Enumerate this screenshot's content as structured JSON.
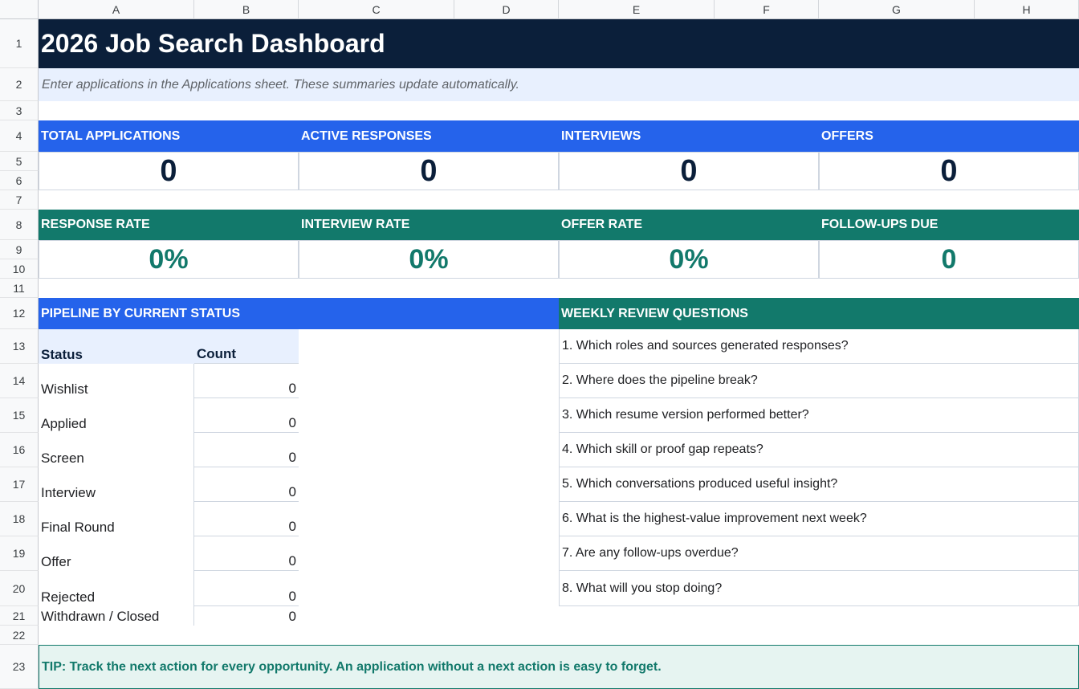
{
  "columns": [
    "A",
    "B",
    "C",
    "D",
    "E",
    "F",
    "G",
    "H"
  ],
  "rows": [
    "1",
    "2",
    "3",
    "4",
    "5",
    "6",
    "7",
    "8",
    "9",
    "10",
    "11",
    "12",
    "13",
    "14",
    "15",
    "16",
    "17",
    "18",
    "19",
    "20",
    "21",
    "22",
    "23"
  ],
  "title": "2026 Job Search Dashboard",
  "subtitle": "Enter applications in the Applications sheet. These summaries update automatically.",
  "kpis_top": [
    {
      "label": "TOTAL APPLICATIONS",
      "value": "0"
    },
    {
      "label": "ACTIVE RESPONSES",
      "value": "0"
    },
    {
      "label": "INTERVIEWS",
      "value": "0"
    },
    {
      "label": "OFFERS",
      "value": "0"
    }
  ],
  "kpis_rates": [
    {
      "label": "RESPONSE RATE",
      "value": "0%"
    },
    {
      "label": "INTERVIEW RATE",
      "value": "0%"
    },
    {
      "label": "OFFER RATE",
      "value": "0%"
    },
    {
      "label": "FOLLOW-UPS DUE",
      "value": "0"
    }
  ],
  "pipeline": {
    "title": "PIPELINE BY CURRENT STATUS",
    "col_status": "Status",
    "col_count": "Count",
    "rows": [
      {
        "status": "Wishlist",
        "count": "0"
      },
      {
        "status": "Applied",
        "count": "0"
      },
      {
        "status": "Screen",
        "count": "0"
      },
      {
        "status": "Interview",
        "count": "0"
      },
      {
        "status": "Final Round",
        "count": "0"
      },
      {
        "status": "Offer",
        "count": "0"
      },
      {
        "status": "Rejected",
        "count": "0"
      },
      {
        "status": "Withdrawn / Closed",
        "count": "0"
      }
    ]
  },
  "weekly_review": {
    "title": "WEEKLY REVIEW QUESTIONS",
    "questions": [
      "1. Which roles and sources generated responses?",
      "2. Where does the pipeline break?",
      "3. Which resume version performed better?",
      "4. Which skill or proof gap repeats?",
      "5. Which conversations produced useful insight?",
      "6. What is the highest-value improvement next week?",
      "7. Are any follow-ups overdue?",
      "8. What will you stop doing?"
    ]
  },
  "tip": "TIP: Track the next action for every opportunity. An application without a next action is easy to forget.",
  "colors": {
    "navy": "#0b1f3a",
    "blue": "#2563eb",
    "teal": "#12796b",
    "light_blue": "#e8f0fe",
    "light_teal": "#e6f4f1"
  }
}
